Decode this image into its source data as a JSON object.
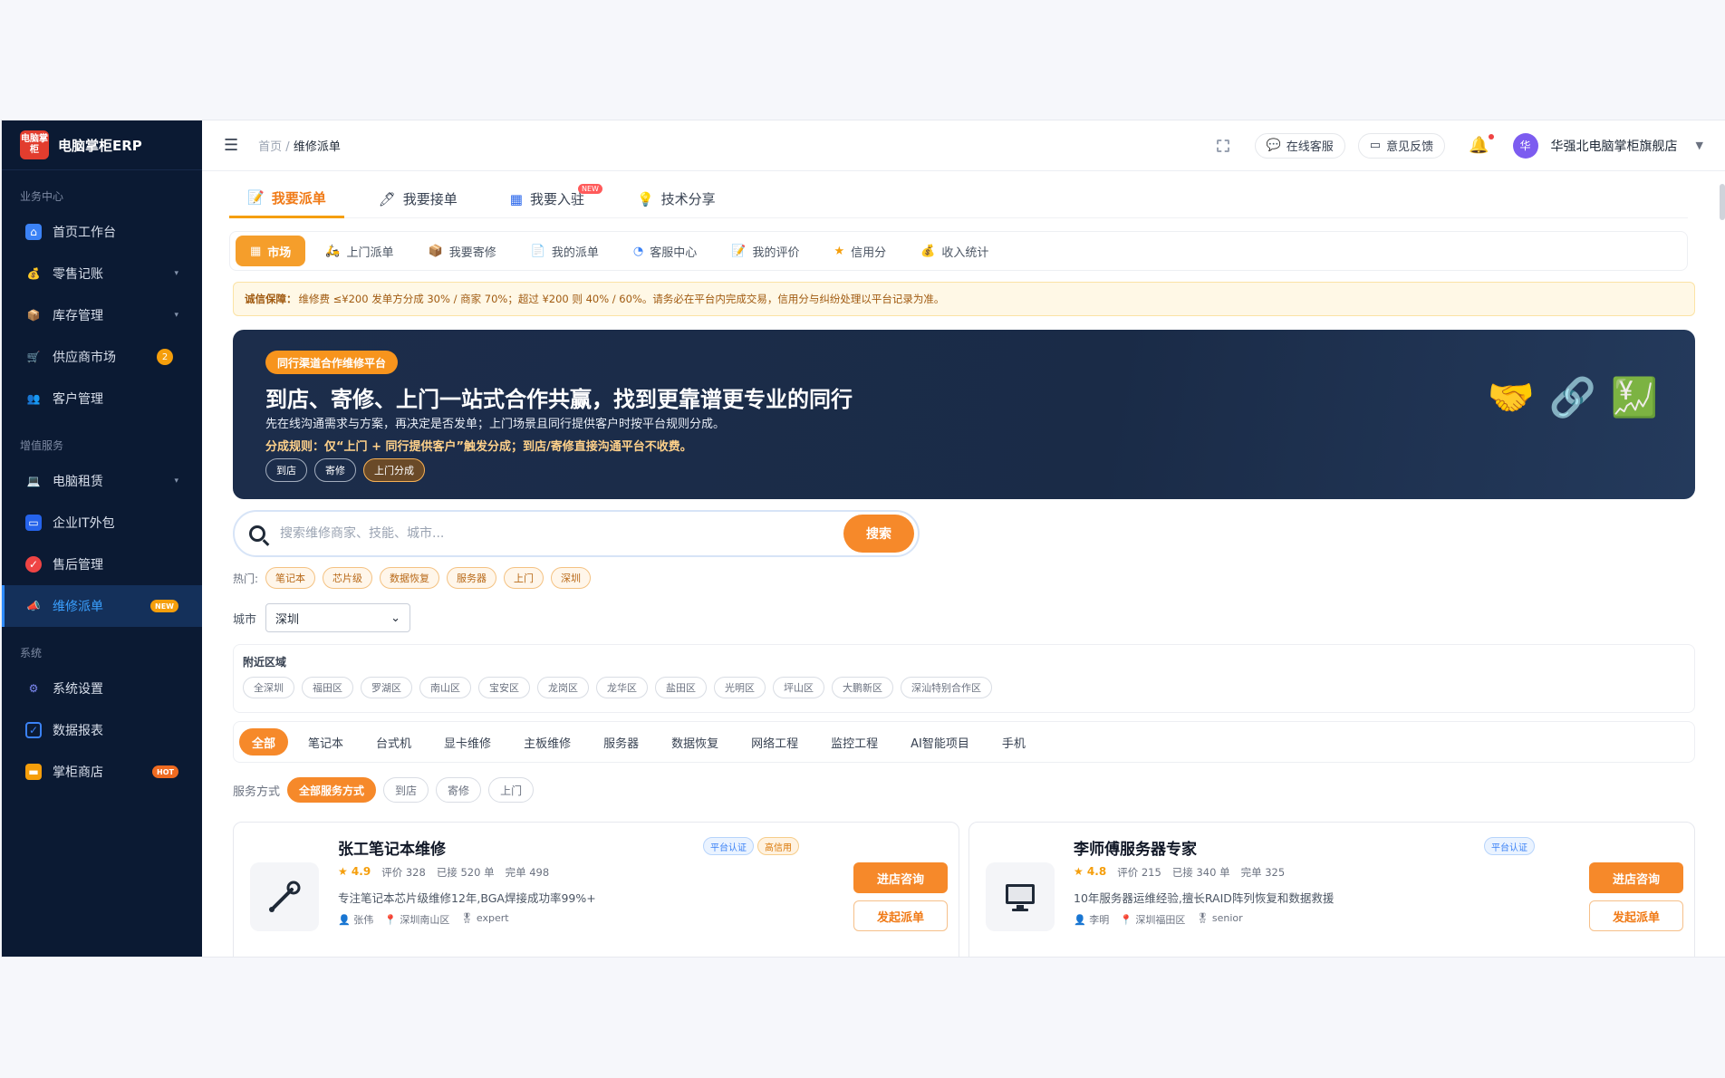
{
  "brand": {
    "logo_text": "电脑掌柜",
    "name": "电脑掌柜ERP"
  },
  "sidebar": {
    "sections": [
      {
        "title": "业务中心",
        "items": [
          {
            "label": "首页工作台",
            "icon": "home-icon"
          },
          {
            "label": "零售记账",
            "icon": "money-bag-icon",
            "caret": "▾"
          },
          {
            "label": "库存管理",
            "icon": "box-icon",
            "caret": "▾"
          },
          {
            "label": "供应商市场",
            "icon": "cart-icon",
            "badge": "2"
          },
          {
            "label": "客户管理",
            "icon": "users-icon"
          }
        ]
      },
      {
        "title": "增值服务",
        "items": [
          {
            "label": "电脑租赁",
            "icon": "laptop-icon",
            "caret": "▾"
          },
          {
            "label": "企业IT外包",
            "icon": "monitor-icon"
          },
          {
            "label": "售后管理",
            "icon": "shield-icon"
          },
          {
            "label": "维修派单",
            "icon": "megaphone-icon",
            "tag": "NEW",
            "active": true
          }
        ]
      },
      {
        "title": "系统",
        "items": [
          {
            "label": "系统设置",
            "icon": "gear-icon"
          },
          {
            "label": "数据报表",
            "icon": "chart-icon"
          },
          {
            "label": "掌柜商店",
            "icon": "store-icon",
            "tag": "HOT"
          }
        ]
      }
    ]
  },
  "header": {
    "breadcrumb_home": "首页",
    "breadcrumb_sep": " / ",
    "breadcrumb_current": "维修派单",
    "online_service": "在线客服",
    "feedback": "意见反馈",
    "user_avatar": "华",
    "user_name": "华强北电脑掌柜旗舰店"
  },
  "main_tabs": [
    {
      "label": "我要派单",
      "icon": "📝",
      "active": true
    },
    {
      "label": "我要接单",
      "icon": "🖊"
    },
    {
      "label": "我要入驻",
      "icon": "▦",
      "flag": "NEW"
    },
    {
      "label": "技术分享",
      "icon": "💡"
    }
  ],
  "sub_tabs": [
    {
      "label": "市场",
      "icon": "▦",
      "active": true
    },
    {
      "label": "上门派单",
      "icon": "🛵"
    },
    {
      "label": "我要寄修",
      "icon": "📦"
    },
    {
      "label": "我的派单",
      "icon": "📄"
    },
    {
      "label": "客服中心",
      "icon": "◔"
    },
    {
      "label": "我的评价",
      "icon": "📝"
    },
    {
      "label": "信用分",
      "icon": "★"
    },
    {
      "label": "收入统计",
      "icon": "💰"
    }
  ],
  "notice": {
    "title": "诚信保障：",
    "text": "维修费 ≤¥200 发单方分成 30% / 商家 70%；超过 ¥200 则 40% / 60%。请务必在平台内完成交易，信用分与纠纷处理以平台记录为准。"
  },
  "hero": {
    "pill": "同行渠道合作维修平台",
    "title": "到店、寄修、上门一站式合作共赢，找到更靠谱更专业的同行",
    "desc": "先在线沟通需求与方案，再决定是否发单；上门场景且同行提供客户时按平台规则分成。",
    "rule": "分成规则：仅“上门 + 同行提供客户”触发分成；到店/寄修直接沟通平台不收费。",
    "tags": [
      "到店",
      "寄修",
      "上门分成"
    ],
    "icons": [
      "🤝",
      "🔗",
      "💹"
    ]
  },
  "search": {
    "placeholder": "搜索维修商家、技能、城市...",
    "button": "搜索"
  },
  "hot": {
    "label": "热门:",
    "items": [
      "笔记本",
      "芯片级",
      "数据恢复",
      "服务器",
      "上门",
      "深圳"
    ]
  },
  "city": {
    "label": "城市",
    "value": "深圳"
  },
  "nearby": {
    "title": "附近区域",
    "items": [
      "全深圳",
      "福田区",
      "罗湖区",
      "南山区",
      "宝安区",
      "龙岗区",
      "龙华区",
      "盐田区",
      "光明区",
      "坪山区",
      "大鹏新区",
      "深汕特别合作区"
    ]
  },
  "categories": [
    "全部",
    "笔记本",
    "台式机",
    "显卡维修",
    "主板维修",
    "服务器",
    "数据恢复",
    "网络工程",
    "监控工程",
    "AI智能项目",
    "手机"
  ],
  "service_mode": {
    "label": "服务方式",
    "items": [
      "全部服务方式",
      "到店",
      "寄修",
      "上门"
    ]
  },
  "cards": [
    {
      "name": "张工笔记本维修",
      "badges": [
        "平台认证",
        "高信用"
      ],
      "rating": "★ 4.9",
      "reviews": "评价 328",
      "accepted": "已接 520 单",
      "completed": "完单 498",
      "desc": "专注笔记本芯片级维修12年,BGA焊接成功率99%+",
      "person": "张伟",
      "location": "深圳南山区",
      "level": "expert",
      "icon": "wrench-icon",
      "btn_consult": "进店咨询",
      "btn_dispatch": "发起派单"
    },
    {
      "name": "李师傅服务器专家",
      "badges": [
        "平台认证"
      ],
      "rating": "★ 4.8",
      "reviews": "评价 215",
      "accepted": "已接 340 单",
      "completed": "完单 325",
      "desc": "10年服务器运维经验,擅长RAID阵列恢复和数据救援",
      "person": "李明",
      "location": "深圳福田区",
      "level": "senior",
      "icon": "monitor-icon",
      "btn_consult": "进店咨询",
      "btn_dispatch": "发起派单"
    }
  ],
  "colors": {
    "accent": "#f6892a",
    "sidebar": "#0b1a33",
    "active_blue": "#3aa0ff"
  }
}
